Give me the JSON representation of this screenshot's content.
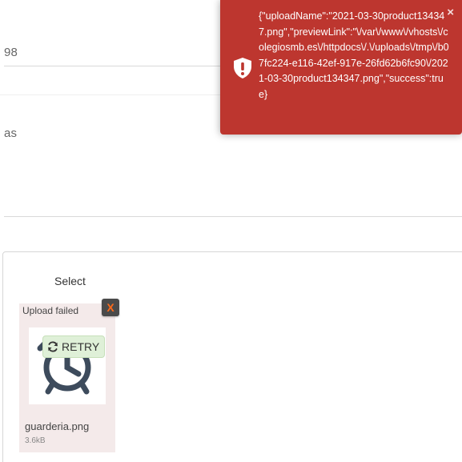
{
  "form": {
    "field1_value": "98",
    "field2_value": "as"
  },
  "uploader": {
    "select_label": "Select",
    "file": {
      "status": "Upload failed",
      "remove_label": "X",
      "retry_label": "RETRY",
      "name": "guarderia.png",
      "size": "3.6kB"
    }
  },
  "toast": {
    "type": "error",
    "close_label": "×",
    "message": "{\"uploadName\":\"2021-03-30product134347.png\",\"previewLink\":\"\\/var\\/www\\/vhosts\\/colegiosmb.es\\/httpdocs\\/.\\/uploads\\/tmp\\/b07fc224-e116-42ef-917e-26fd62b6fc90\\/2021-03-30product134347.png\",\"success\":true}"
  },
  "colors": {
    "toast_background": "#bd362f",
    "retry_background": "#dff0d8",
    "file_card_background": "#f4eaea",
    "remove_button": "#4a4a4a",
    "remove_x": "#ff6a1a"
  },
  "icons": {
    "toast_icon": "shield-exclamation-icon",
    "retry_icon": "refresh-icon",
    "thumbnail": "alarm-clock-icon"
  }
}
